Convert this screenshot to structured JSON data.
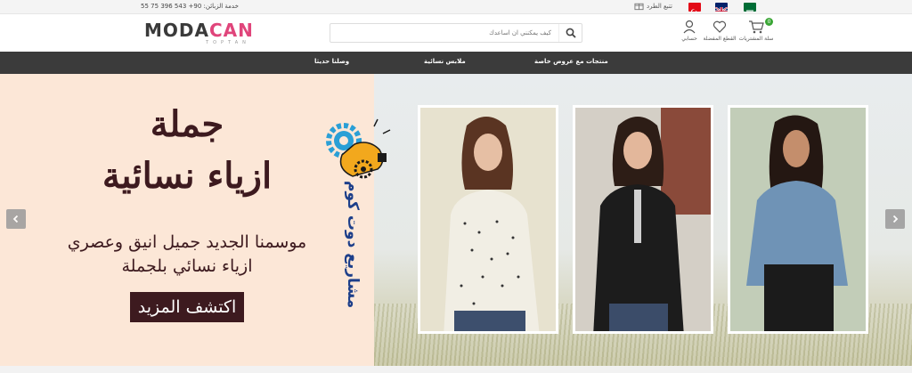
{
  "topbar": {
    "phone": "خدمة الزبائن: 90+ 543 396 75 55",
    "track_label": "تتبع الطرد",
    "flags": [
      "turkey",
      "uk",
      "saudi-arabia"
    ]
  },
  "header": {
    "logo_main_a": "MODA",
    "logo_main_b": "CAN",
    "logo_sub": "TOPTAN",
    "search_placeholder": "كيف يمكنني ان اساعدك",
    "account_label": "حسابي",
    "favorites_label": "القطع المفضلة",
    "cart_label": "سلة المشتريات",
    "cart_count": "0"
  },
  "nav": {
    "items": [
      "منتجات مع عروض خاصة",
      "ملابس نسائية",
      "وصلنا حديثا"
    ]
  },
  "hero": {
    "title_line1": "جملة",
    "title_line2": "ازياء نسائية",
    "desc_line1": "موسمنا الجديد جميل انيق وعصري",
    "desc_line2": "ازياء نسائي بلجملة",
    "cta_label": "اكتشف المزيد",
    "watermark": "مشاريع دوت كوم"
  },
  "colors": {
    "accent_pink": "#e0457b",
    "nav_bg": "#3b3b3b",
    "hero_bg": "#fce7d7",
    "hero_text": "#3d1a1f",
    "badge_green": "#3aa635"
  }
}
